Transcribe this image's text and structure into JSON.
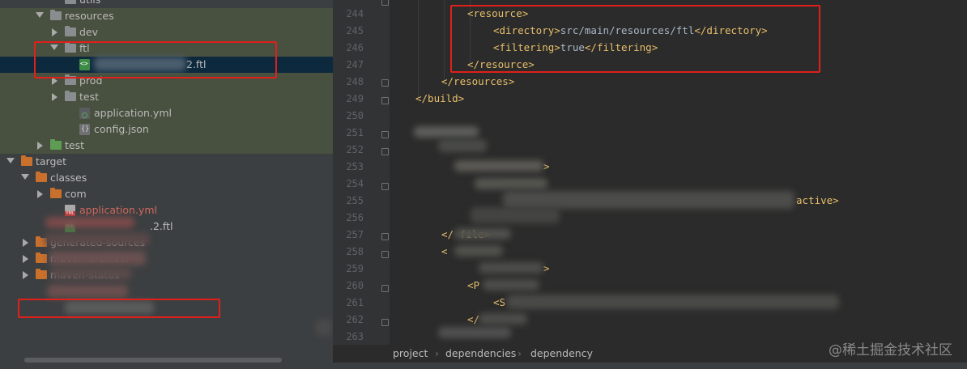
{
  "tree": {
    "items": [
      {
        "label": "utils",
        "indent": 3,
        "kind": "folder-gray"
      },
      {
        "label": "resources",
        "indent": 2,
        "kind": "folder-res",
        "expanded": true
      },
      {
        "label": "dev",
        "indent": 3,
        "kind": "folder-gray",
        "expanded": false
      },
      {
        "label": "ftl",
        "indent": 3,
        "kind": "folder-gray",
        "expanded": true
      },
      {
        "label": "2.ftl",
        "indent": 4,
        "kind": "ftl",
        "selected": true
      },
      {
        "label": "prod",
        "indent": 3,
        "kind": "folder-gray",
        "expanded": false
      },
      {
        "label": "test",
        "indent": 3,
        "kind": "folder-gray",
        "expanded": false
      },
      {
        "label": "application.yml",
        "indent": 4,
        "kind": "yml"
      },
      {
        "label": "config.json",
        "indent": 4,
        "kind": "json"
      },
      {
        "label": "test",
        "indent": 2,
        "kind": "folder-green",
        "expanded": false
      },
      {
        "label": "target",
        "indent": 0,
        "kind": "folder-orange",
        "expanded": true
      },
      {
        "label": "classes",
        "indent": 1,
        "kind": "folder-orange",
        "expanded": true
      },
      {
        "label": "com",
        "indent": 2,
        "kind": "folder-orange",
        "expanded": false
      },
      {
        "label": "application.yml",
        "indent": 3,
        "kind": "yml-red"
      },
      {
        "label": ".2.ftl",
        "indent": 3,
        "kind": "ftl"
      },
      {
        "label": "generated-sources",
        "indent": 1,
        "kind": "folder-orange",
        "expanded": false
      },
      {
        "label": "maven-archiver",
        "indent": 1,
        "kind": "folder-orange",
        "expanded": false
      },
      {
        "label": "maven-status",
        "indent": 1,
        "kind": "folder-orange",
        "expanded": false
      }
    ]
  },
  "editor": {
    "line_numbers": [
      "244",
      "245",
      "246",
      "247",
      "248",
      "249",
      "250",
      "251",
      "252",
      "253",
      "254",
      "255",
      "256",
      "257",
      "258",
      "259",
      "260",
      "261",
      "262",
      "263"
    ],
    "lines": [
      {
        "open": "<resource>",
        "text": "",
        "close": ""
      },
      {
        "open": "<directory>",
        "text": "src/main/resources/ftl",
        "close": "</directory>"
      },
      {
        "open": "<filtering>",
        "text": "true",
        "close": "</filtering>"
      },
      {
        "open": "</resource>",
        "text": "",
        "close": ""
      },
      {
        "open": "</resources>",
        "text": "",
        "close": ""
      },
      {
        "open": "</build>",
        "text": "",
        "close": ""
      }
    ],
    "partial_text": {
      "line255": "active>",
      "line257": "</ file>",
      "line258": "<",
      "line259": ">",
      "line260": "<P",
      "line261": "<S",
      "line262": "</",
      "line253": ">"
    }
  },
  "breadcrumbs": [
    "project",
    "dependencies",
    "dependency"
  ],
  "watermark": "@稀土掘金技术社区",
  "colors": {
    "tag": "#e8bf6a",
    "text": "#a9b7c6",
    "tree_bg": "#3c3f41",
    "editor_bg": "#2b2b2b",
    "selection": "#0d293e",
    "highlight_box": "#e0201a"
  }
}
